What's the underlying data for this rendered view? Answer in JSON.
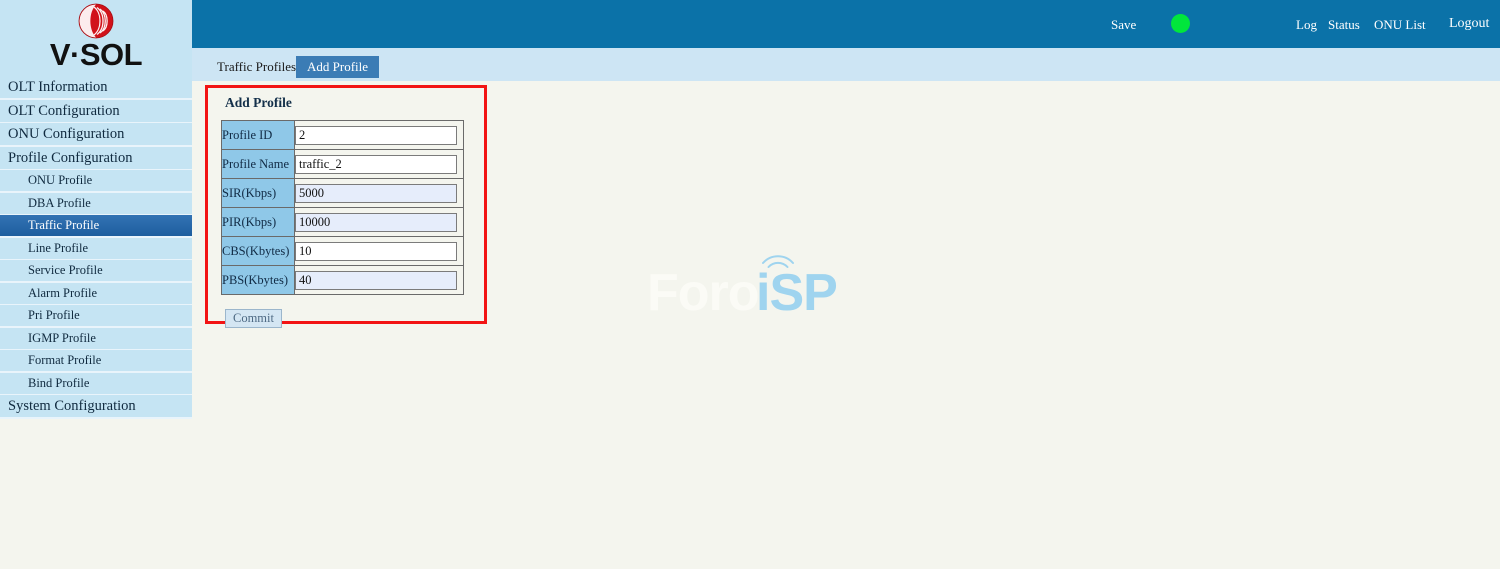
{
  "brand": {
    "wordmark": "V·SOL",
    "emblem_icon": "vsol-emblem-icon",
    "emblem_color": "#d1121a"
  },
  "header": {
    "save_label": "Save",
    "status_dot": {
      "icon": "status-dot-icon",
      "color": "#01e63c"
    },
    "links": [
      {
        "label": "Log"
      },
      {
        "label": "Status"
      },
      {
        "label": "ONU List"
      },
      {
        "label": "Logout"
      }
    ],
    "background_color": "#0b72a8"
  },
  "tabs": [
    {
      "label": "Traffic Profiles",
      "active": false
    },
    {
      "label": "Add Profile",
      "active": true
    }
  ],
  "sidebar": {
    "items": [
      {
        "label": "OLT Information",
        "level": "top",
        "active": false
      },
      {
        "label": "OLT Configuration",
        "level": "top",
        "active": false
      },
      {
        "label": "ONU Configuration",
        "level": "top",
        "active": false
      },
      {
        "label": "Profile Configuration",
        "level": "top",
        "active": false
      },
      {
        "label": "ONU Profile",
        "level": "sub",
        "active": false
      },
      {
        "label": "DBA Profile",
        "level": "sub",
        "active": false
      },
      {
        "label": "Traffic Profile",
        "level": "sub",
        "active": true
      },
      {
        "label": "Line Profile",
        "level": "sub",
        "active": false
      },
      {
        "label": "Service Profile",
        "level": "sub",
        "active": false
      },
      {
        "label": "Alarm Profile",
        "level": "sub",
        "active": false
      },
      {
        "label": "Pri Profile",
        "level": "sub",
        "active": false
      },
      {
        "label": "IGMP Profile",
        "level": "sub",
        "active": false
      },
      {
        "label": "Format Profile",
        "level": "sub",
        "active": false
      },
      {
        "label": "Bind Profile",
        "level": "sub",
        "active": false
      },
      {
        "label": "System Configuration",
        "level": "top",
        "active": false
      }
    ]
  },
  "panel": {
    "title": "Add Profile",
    "highlight_color": "#f21414",
    "fields": [
      {
        "label": "Profile ID",
        "value": "2",
        "tinted": false
      },
      {
        "label": "Profile Name",
        "value": "traffic_2",
        "tinted": false
      },
      {
        "label": "SIR(Kbps)",
        "value": "5000",
        "tinted": true
      },
      {
        "label": "PIR(Kbps)",
        "value": "10000",
        "tinted": true
      },
      {
        "label": "CBS(Kbytes)",
        "value": "10",
        "tinted": false
      },
      {
        "label": "PBS(Kbytes)",
        "value": "40",
        "tinted": true
      }
    ],
    "commit_label": "Commit"
  },
  "watermark": {
    "text_light": "Foro",
    "text_accent": "iSP",
    "wifi_icon": "wifi-arcs-icon",
    "accent_color": "#9fd4ef"
  }
}
